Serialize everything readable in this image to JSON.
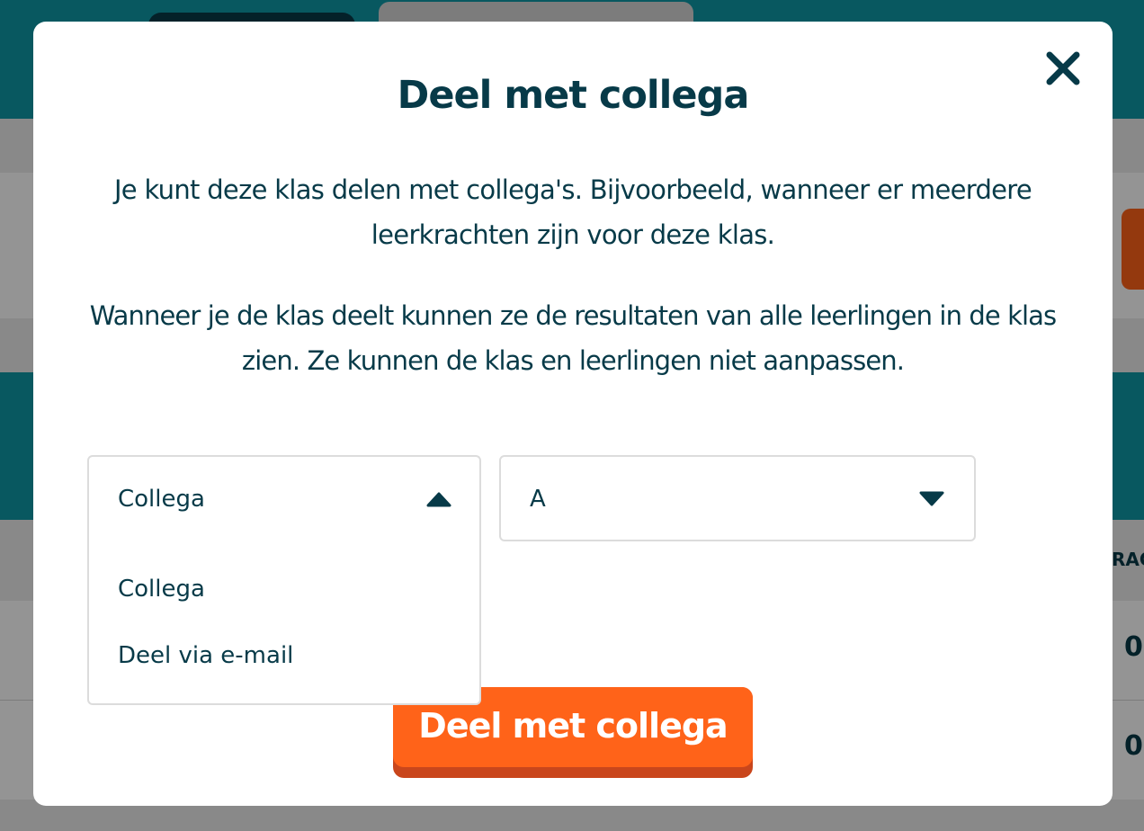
{
  "background": {
    "column_header": "RAC",
    "row_values": [
      "0",
      "0"
    ]
  },
  "modal": {
    "title": "Deel met collega",
    "close_icon": "close-icon",
    "description_1": "Je kunt deze klas delen met collega's. Bijvoorbeeld, wanneer er meerdere leerkrachten zijn voor deze klas.",
    "description_2": "Wanneer je de klas deelt kunnen ze de resultaten van alle leerlingen in de klas zien. Ze kunnen de klas en leerlingen niet aanpassen.",
    "share_type_select": {
      "selected": "Collega",
      "expanded": true,
      "options": [
        "Collega",
        "Deel via e-mail"
      ],
      "icon": "caret-up-icon"
    },
    "colleague_select": {
      "selected": "A",
      "expanded": false,
      "icon": "caret-down-icon"
    },
    "submit_label": "Deel met collega"
  },
  "colors": {
    "primary_text": "#073a48",
    "accent_orange": "#ff6319",
    "teal": "#0e98a6"
  }
}
